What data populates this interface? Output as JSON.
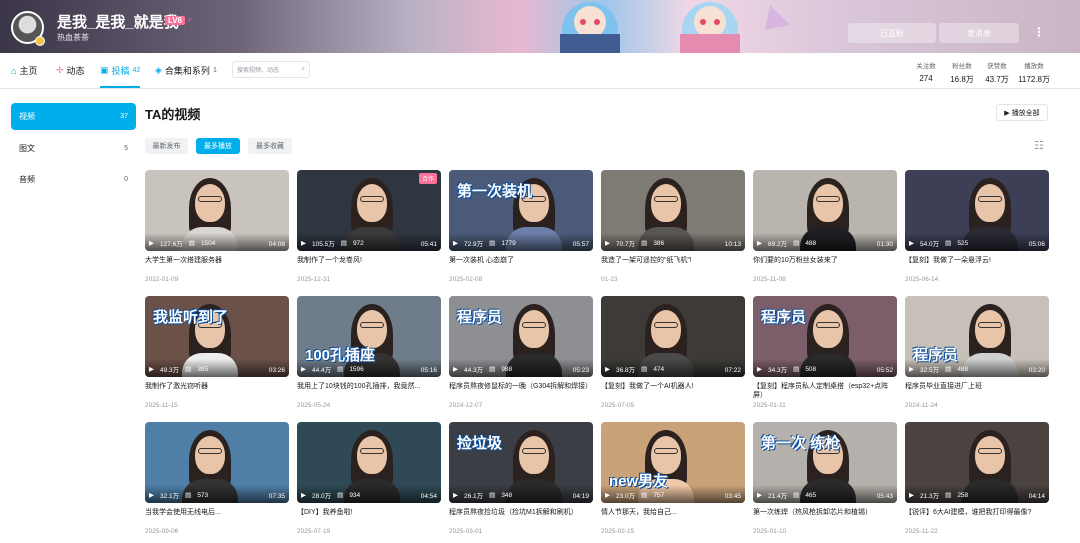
{
  "profile": {
    "name": "是我_是我_就是我",
    "level": "LV6",
    "gender": "♂",
    "sign": "热血茶茶"
  },
  "actions": {
    "follow": "已互粉",
    "message": "发消息",
    "more": "⋮"
  },
  "nav": {
    "tabs": [
      {
        "label": "主页",
        "icon": "home-icon"
      },
      {
        "label": "动态",
        "icon": "activity-icon"
      },
      {
        "label": "投稿",
        "count": "42",
        "icon": "upload-icon"
      },
      {
        "label": "合集和系列",
        "count": "1",
        "icon": "collection-icon"
      }
    ],
    "search_placeholder": "搜索视频、动态"
  },
  "stats": [
    {
      "label": "关注数",
      "value": "274"
    },
    {
      "label": "粉丝数",
      "value": "16.8万"
    },
    {
      "label": "获赞数",
      "value": "43.7万"
    },
    {
      "label": "播放数",
      "value": "1172.8万"
    }
  ],
  "sidebar": [
    {
      "label": "视频",
      "count": "37"
    },
    {
      "label": "图文",
      "count": "5"
    },
    {
      "label": "音频",
      "count": "0"
    }
  ],
  "main": {
    "title": "TA的视频",
    "play_all": "播放全部",
    "sort": [
      "最新发布",
      "最多播放",
      "最多收藏"
    ]
  },
  "videos": [
    {
      "title": "大学生第一次搭建服务器",
      "date": "2022-01-09",
      "plays": "127.6万",
      "danmaku": "1504",
      "duration": "04:08",
      "bg": "#c9c3bd",
      "shirt": "#d8d4cf",
      "overlay": "",
      "tag": ""
    },
    {
      "title": "我制作了一个龙卷风!",
      "date": "2025-12-31",
      "plays": "105.5万",
      "danmaku": "972",
      "duration": "05:41",
      "bg": "#2f3640",
      "shirt": "#3a3a3a",
      "overlay": "",
      "tag": "合作"
    },
    {
      "title": "第一次装机 心态崩了",
      "date": "2025-02-08",
      "plays": "72.9万",
      "danmaku": "1779",
      "duration": "05:57",
      "bg": "#4a5a78",
      "shirt": "#6b7fa8",
      "overlay": "第一次装机",
      "tag": ""
    },
    {
      "title": "我造了一架可遥控的“纸飞机”!",
      "date": "01-23",
      "plays": "70.7万",
      "danmaku": "386",
      "duration": "10:13",
      "bg": "#7e7a74",
      "shirt": "#5a5653",
      "overlay": "",
      "tag": ""
    },
    {
      "title": "你们要的10万粉丝女装来了",
      "date": "2025-11-08",
      "plays": "69.2万",
      "danmaku": "488",
      "duration": "01:30",
      "bg": "#b9b4ad",
      "shirt": "#1f1f22",
      "overlay": "",
      "tag": ""
    },
    {
      "title": "【复刻】我做了一朵悬浮云!",
      "date": "2025-06-14",
      "plays": "54.0万",
      "danmaku": "525",
      "duration": "05:06",
      "bg": "#3c3f55",
      "shirt": "#2a2a35",
      "overlay": "",
      "tag": ""
    },
    {
      "title": "我制作了激光窃听器",
      "date": "2025-11-15",
      "plays": "49.3万",
      "danmaku": "395",
      "duration": "03:26",
      "bg": "#6b5148",
      "shirt": "#eeeeee",
      "overlay": "我监听到了",
      "tag": ""
    },
    {
      "title": "我用上了10块钱的100孔插排，我竟然...",
      "date": "2025-05-24",
      "plays": "44.4万",
      "danmaku": "1596",
      "duration": "05:16",
      "bg": "#6f7d8a",
      "shirt": "#333333",
      "overlay": "100孔插座",
      "tag": ""
    },
    {
      "title": "程序员熬夜修鼠标的一晚（G304拆解和焊接）",
      "date": "2024-12-07",
      "plays": "44.3万",
      "danmaku": "988",
      "duration": "05:23",
      "bg": "#8d8f92",
      "shirt": "#2a2a2a",
      "overlay": "程序员",
      "tag": ""
    },
    {
      "title": "【复刻】我做了一个AI机器人!",
      "date": "2025-07-05",
      "plays": "36.8万",
      "danmaku": "474",
      "duration": "07:22",
      "bg": "#3d3a37",
      "shirt": "#4a4a4a",
      "overlay": "",
      "tag": ""
    },
    {
      "title": "【复刻】程序员私人定制桌搭（esp32+点阵屏）",
      "date": "2025-01-11",
      "plays": "34.3万",
      "danmaku": "508",
      "duration": "05:52",
      "bg": "#7c5e6a",
      "shirt": "#2a2a2a",
      "overlay": "程序员",
      "tag": ""
    },
    {
      "title": "程序员毕业直接进厂上班",
      "date": "2024-11-24",
      "plays": "32.5万",
      "danmaku": "488",
      "duration": "03:20",
      "bg": "#c7c0b8",
      "shirt": "#d0d0d0",
      "overlay": "程序员",
      "tag": ""
    },
    {
      "title": "当我学会使用无线电后...",
      "date": "2025-09-06",
      "plays": "32.1万",
      "danmaku": "573",
      "duration": "07:35",
      "bg": "#4f7fa7",
      "shirt": "#333333",
      "overlay": "",
      "tag": ""
    },
    {
      "title": "【DIY】我养鱼啦!",
      "date": "2025-07-19",
      "plays": "28.0万",
      "danmaku": "934",
      "duration": "04:54",
      "bg": "#2f4a56",
      "shirt": "#2a2a2a",
      "overlay": "",
      "tag": ""
    },
    {
      "title": "程序员熬夜捡垃圾（捡坑M1拆解和刷机）",
      "date": "2025-03-01",
      "plays": "26.1万",
      "danmaku": "348",
      "duration": "04:19",
      "bg": "#3b3e45",
      "shirt": "#2a2a2a",
      "overlay": "捡垃圾",
      "tag": ""
    },
    {
      "title": "情人节那天，我给自己...",
      "date": "2025-02-15",
      "plays": "23.0万",
      "danmaku": "757",
      "duration": "03:45",
      "bg": "#c9a27a",
      "shirt": "#f1c9a8",
      "overlay": "new男友",
      "tag": ""
    },
    {
      "title": "第一次练焊（热风枪拆卸芯片和植锡）",
      "date": "2025-01-10",
      "plays": "21.4万",
      "danmaku": "465",
      "duration": "05:43",
      "bg": "#b4b0ab",
      "shirt": "#2a2a2a",
      "overlay": "第一次 练枪",
      "tag": ""
    },
    {
      "title": "【锐评】6大AI建模，谁把我打印得最像?",
      "date": "2025-11-22",
      "plays": "21.3万",
      "danmaku": "258",
      "duration": "04:14",
      "bg": "#4a4340",
      "shirt": "#2a2a2a",
      "overlay": "",
      "tag": ""
    }
  ]
}
